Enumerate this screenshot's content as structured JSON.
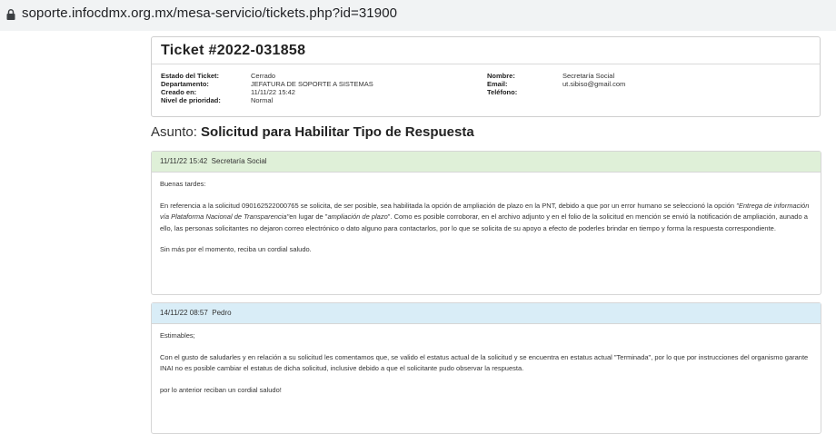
{
  "browser": {
    "url": "soporte.infocdmx.org.mx/mesa-servicio/tickets.php?id=31900"
  },
  "ticket": {
    "title": "Ticket #2022-031858",
    "fields_left": [
      {
        "label": "Estado del Ticket:",
        "value": "Cerrado"
      },
      {
        "label": "Departamento:",
        "value": "JEFATURA DE SOPORTE A SISTEMAS"
      },
      {
        "label": "Creado en:",
        "value": "11/11/22 15:42"
      },
      {
        "label": "Nivel de prioridad:",
        "value": "Normal"
      }
    ],
    "fields_right": [
      {
        "label": "Nombre:",
        "value": "Secretaría Social"
      },
      {
        "label": "Email:",
        "value": "ut.sibiso@gmail.com"
      },
      {
        "label": "Teléfono:",
        "value": ""
      }
    ]
  },
  "subject": {
    "prefix": "Asunto:",
    "text": "Solicitud para Habilitar Tipo de Respuesta"
  },
  "messages": [
    {
      "timestamp": "11/11/22 15:42",
      "author": "Secretaría Social",
      "greeting": "Buenas tardes:",
      "body_part1": "En referencia a la solicitud 090162522000765 se solicita, de ser posible, sea habilitada la opción de ampliación de plazo en la PNT, debido a que por un error humano se seleccionó la opción ",
      "body_italic1": "\"Entrega de información vía Plataforma Nacional de Transparencia\"",
      "body_part2": "en lugar de \"",
      "body_italic2": "ampliación de plazo",
      "body_part3": "\". Como es posible corroborar, en el archivo adjunto y en el folio de la solicitud en mención se envió la notificación de ampliación, aunado a ello, las personas solicitantes no dejaron correo electrónico o dato alguno para contactarlos, por lo que se solicita de su apoyo a efecto de poderles brindar en tiempo y forma la respuesta correspondiente.",
      "closing": "Sin más por el momento, reciba un cordial saludo."
    },
    {
      "timestamp": "14/11/22 08:57",
      "author": "Pedro",
      "greeting": "Estimables;",
      "body": "Con el gusto de saludarles y en relación a su solicitud les comentamos que, se valido el estatus actual de la solicitud y se encuentra en estatus actual \"Terminada\", por lo que por instrucciones del organismo garante INAI no es posible cambiar el estatus de dicha solicitud, inclusive debido a que el solicitante pudo observar la respuesta.",
      "closing": "por lo anterior reciban un cordial saludo!"
    }
  ]
}
